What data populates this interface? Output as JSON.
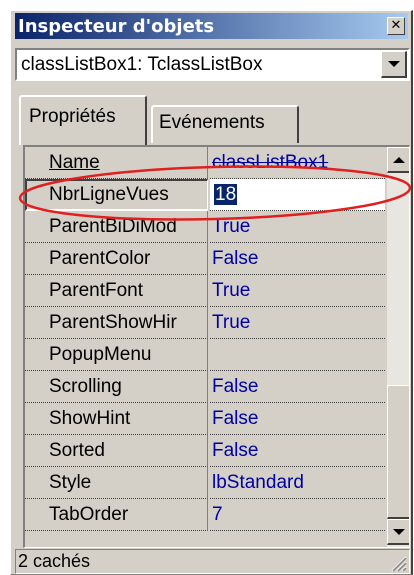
{
  "window": {
    "title": "Inspecteur d'objets",
    "close_icon": "close-icon"
  },
  "object_selector": {
    "value": "classListBox1: TclassListBox"
  },
  "tabs": [
    {
      "label": "Propriétés"
    },
    {
      "label": "Evénements"
    }
  ],
  "properties": [
    {
      "name": "Name",
      "value": "classListBox1"
    },
    {
      "name": "NbrLigneVues",
      "value": "18"
    },
    {
      "name": "ParentBiDiMod",
      "value": "True"
    },
    {
      "name": "ParentColor",
      "value": "False"
    },
    {
      "name": "ParentFont",
      "value": "True"
    },
    {
      "name": "ParentShowHir",
      "value": "True"
    },
    {
      "name": "PopupMenu",
      "value": ""
    },
    {
      "name": "Scrolling",
      "value": "False"
    },
    {
      "name": "ShowHint",
      "value": "False"
    },
    {
      "name": "Sorted",
      "value": "False"
    },
    {
      "name": "Style",
      "value": "lbStandard"
    },
    {
      "name": "TabOrder",
      "value": "7"
    }
  ],
  "status": {
    "text": "2 cachés"
  },
  "colors": {
    "title_start": "#0a246a",
    "title_end": "#a6caf0",
    "value_text": "#0000a0",
    "annotation": "#e02020"
  }
}
